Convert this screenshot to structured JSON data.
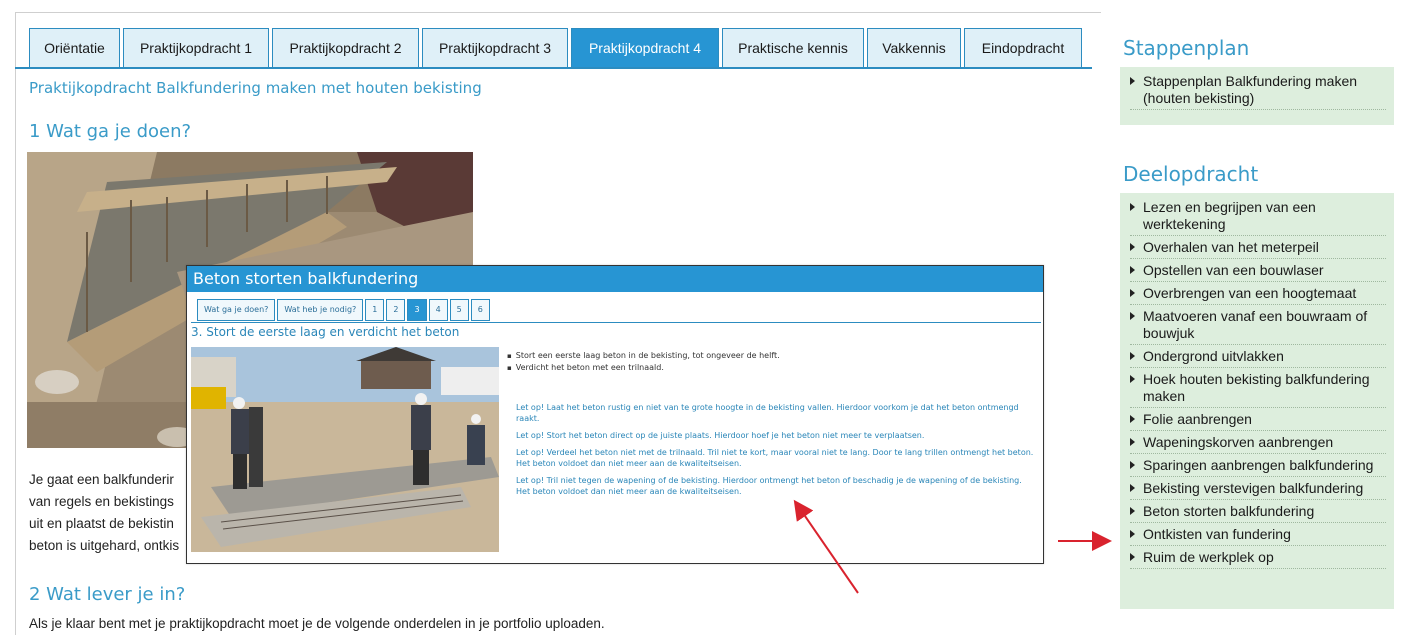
{
  "tabs": [
    {
      "label": "Oriëntatie"
    },
    {
      "label": "Praktijkopdracht 1"
    },
    {
      "label": "Praktijkopdracht 2"
    },
    {
      "label": "Praktijkopdracht 3"
    },
    {
      "label": "Praktijkopdracht 4",
      "active": true
    },
    {
      "label": "Praktische kennis"
    },
    {
      "label": "Vakkennis"
    },
    {
      "label": "Eindopdracht"
    }
  ],
  "subtitle": "Praktijkopdracht Balkfundering maken met houten bekisting",
  "section1": {
    "heading": "1   Wat ga je doen?"
  },
  "body_lines": [
    "Je gaat een balkfunderir",
    "van regels en bekistings",
    "uit en plaatst de bekistin",
    "beton is uitgehard, ontkis"
  ],
  "section2": {
    "heading": "2   Wat lever je in?",
    "text": "Als je klaar bent met je praktijkopdracht moet je de volgende onderdelen in je portfolio uploaden."
  },
  "popup": {
    "title": "Beton storten balkfundering",
    "tabs": [
      {
        "label": "Wat ga je doen?"
      },
      {
        "label": "Wat heb je nodig?"
      },
      {
        "label": "1"
      },
      {
        "label": "2"
      },
      {
        "label": "3",
        "active": true
      },
      {
        "label": "4"
      },
      {
        "label": "5"
      },
      {
        "label": "6"
      }
    ],
    "step_title": "3. Stort de eerste laag en verdicht het beton",
    "bullets": [
      "Stort een eerste laag beton in de bekisting, tot ongeveer de helft.",
      "Verdicht het beton met een trilnaald."
    ],
    "notes": [
      "Let op! Laat het beton rustig en niet van te grote hoogte in de bekisting vallen. Hierdoor voorkom je dat het beton ontmengd raakt.",
      "Let op! Stort het beton direct op de juiste plaats. Hierdoor hoef je het beton niet meer te verplaatsen.",
      "Let op! Verdeel het beton niet met de trilnaald. Tril niet te kort, maar vooral niet te lang. Door te lang trillen ontmengt het beton. Het beton voldoet dan niet meer aan de kwaliteitseisen.",
      "Let op! Tril niet tegen de wapening of de bekisting. Hierdoor ontmengt het beton of beschadig je de wapening of de bekisting. Het beton voldoet dan niet meer aan de kwaliteitseisen."
    ]
  },
  "sidebar": {
    "stappenplan_heading": "Stappenplan",
    "stappenplan_items": [
      {
        "label": "Stappenplan Balkfundering maken (houten bekisting)"
      }
    ],
    "deelopdracht_heading": "Deelopdracht",
    "deelopdracht_items": [
      {
        "label": "Lezen en begrijpen van een werktekening"
      },
      {
        "label": "Overhalen van het meterpeil"
      },
      {
        "label": "Opstellen van een bouwlaser"
      },
      {
        "label": "Overbrengen van een hoogtemaat"
      },
      {
        "label": "Maatvoeren vanaf een bouwraam of bouwjuk"
      },
      {
        "label": "Ondergrond uitvlakken"
      },
      {
        "label": "Hoek houten bekisting balkfundering maken"
      },
      {
        "label": "Folie aanbrengen"
      },
      {
        "label": "Wapeningskorven aanbrengen"
      },
      {
        "label": "Sparingen aanbrengen balkfundering"
      },
      {
        "label": "Bekisting verstevigen balkfundering"
      },
      {
        "label": "Beton storten balkfundering"
      },
      {
        "label": "Ontkisten van fundering"
      },
      {
        "label": "Ruim de werkplek op"
      }
    ]
  },
  "colors": {
    "accent": "#2795d3",
    "heading": "#3a9bc8",
    "sidebar_bg": "#ddeedd",
    "arrow": "#d9232e"
  }
}
